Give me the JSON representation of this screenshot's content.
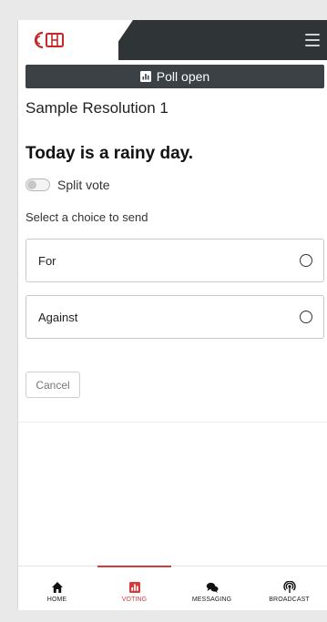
{
  "header": {
    "logo": "logo-icon",
    "menu": "hamburger-icon"
  },
  "banner": {
    "icon": "chart-icon",
    "text": "Poll open"
  },
  "resolution": {
    "title": "Sample Resolution 1",
    "question": "Today is a rainy day.",
    "split_vote_label": "Split vote",
    "select_label": "Select a choice to send"
  },
  "choices": [
    {
      "label": "For"
    },
    {
      "label": "Against"
    }
  ],
  "cancel_label": "Cancel",
  "nav": {
    "items": [
      {
        "label": "HOME",
        "icon": "home-icon"
      },
      {
        "label": "VOTING",
        "icon": "voting-icon"
      },
      {
        "label": "MESSAGING",
        "icon": "messaging-icon"
      },
      {
        "label": "BROADCAST",
        "icon": "broadcast-icon"
      }
    ],
    "active_index": 1
  },
  "colors": {
    "header": "#2f3437",
    "banner": "#3b4145",
    "accent": "#d83a3a",
    "logo": "#c62828"
  }
}
